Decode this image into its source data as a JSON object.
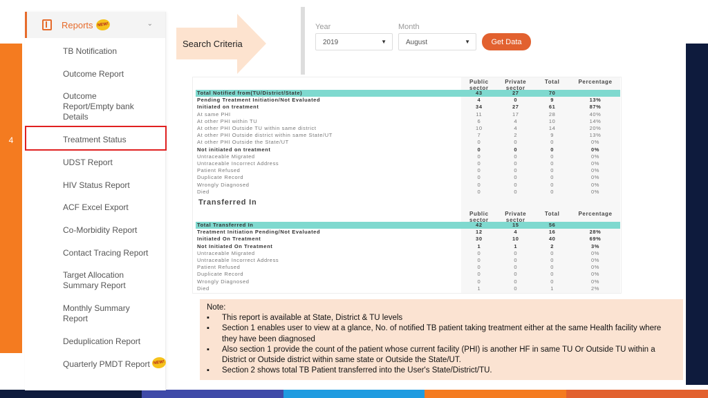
{
  "sidebar": {
    "header": {
      "title": "Reports",
      "badge": "NEW!",
      "icon": "report-icon"
    },
    "items": [
      {
        "label": "TB Notification"
      },
      {
        "label": "Outcome Report"
      },
      {
        "label": "Outcome Report/Empty bank Details"
      },
      {
        "label": "Treatment Status"
      },
      {
        "label": "UDST Report"
      },
      {
        "label": "HIV Status Report"
      },
      {
        "label": "ACF Excel Export"
      },
      {
        "label": "Co-Morbidity Report"
      },
      {
        "label": "Contact Tracing Report"
      },
      {
        "label": "Target Allocation Summary Report"
      },
      {
        "label": "Monthly Summary Report"
      },
      {
        "label": "Deduplication Report"
      },
      {
        "label": "Quarterly PMDT Report"
      }
    ],
    "quarterly_badge": "NEW!",
    "step_number": "4"
  },
  "callout": {
    "label": "Search Criteria"
  },
  "filters": {
    "year_label": "Year",
    "year_value": "2019",
    "month_label": "Month",
    "month_value": "August",
    "get_data_label": "Get Data"
  },
  "report": {
    "columns": [
      "Public sector",
      "Private sector",
      "Total",
      "Percentage"
    ],
    "section1": [
      {
        "label": "Total Notified from(TU/District/State)",
        "v": [
          "43",
          "27",
          "70",
          ""
        ],
        "style": "hl"
      },
      {
        "label": "Pending Treatment Initiation/Not Evaluated",
        "v": [
          "4",
          "0",
          "9",
          "13%"
        ],
        "style": "bold"
      },
      {
        "label": "Initiated on treatment",
        "v": [
          "34",
          "27",
          "61",
          "87%"
        ],
        "style": "bold"
      },
      {
        "label": "At same PHI",
        "v": [
          "11",
          "17",
          "28",
          "40%"
        ],
        "style": "muted"
      },
      {
        "label": "At other PHI within TU",
        "v": [
          "6",
          "4",
          "10",
          "14%"
        ],
        "style": "muted"
      },
      {
        "label": "At other PHI Outside TU within same district",
        "v": [
          "10",
          "4",
          "14",
          "20%"
        ],
        "style": "muted"
      },
      {
        "label": "At other PHI Outside district within same State/UT",
        "v": [
          "7",
          "2",
          "9",
          "13%"
        ],
        "style": "muted"
      },
      {
        "label": "At other PHI Outside the State/UT",
        "v": [
          "0",
          "0",
          "0",
          "0%"
        ],
        "style": "muted"
      },
      {
        "label": "Not initiated on treatment",
        "v": [
          "0",
          "0",
          "0",
          "0%"
        ],
        "style": "bold"
      },
      {
        "label": "Untraceable Migrated",
        "v": [
          "0",
          "0",
          "0",
          "0%"
        ],
        "style": "muted"
      },
      {
        "label": "Untraceable Incorrect Address",
        "v": [
          "0",
          "0",
          "0",
          "0%"
        ],
        "style": "muted"
      },
      {
        "label": "Patient Refused",
        "v": [
          "0",
          "0",
          "0",
          "0%"
        ],
        "style": "muted"
      },
      {
        "label": "Duplicate Record",
        "v": [
          "0",
          "0",
          "0",
          "0%"
        ],
        "style": "muted"
      },
      {
        "label": "Wrongly Diagnosed",
        "v": [
          "0",
          "0",
          "0",
          "0%"
        ],
        "style": "muted"
      },
      {
        "label": "Died",
        "v": [
          "0",
          "0",
          "0",
          "0%"
        ],
        "style": "muted"
      }
    ],
    "section2_title": "Transferred In",
    "section2": [
      {
        "label": "Total Transferred In",
        "v": [
          "42",
          "15",
          "56",
          ""
        ],
        "style": "hl"
      },
      {
        "label": "Treatment Initiation Pending/Not Evaluated",
        "v": [
          "12",
          "4",
          "16",
          "28%"
        ],
        "style": "bold"
      },
      {
        "label": "Initiated On Treatment",
        "v": [
          "30",
          "10",
          "40",
          "69%"
        ],
        "style": "bold"
      },
      {
        "label": "Not Initiated On Treatment",
        "v": [
          "1",
          "1",
          "2",
          "3%"
        ],
        "style": "bold"
      },
      {
        "label": "Untraceable Migrated",
        "v": [
          "0",
          "0",
          "0",
          "0%"
        ],
        "style": "muted"
      },
      {
        "label": "Untraceable Incorrect Address",
        "v": [
          "0",
          "0",
          "0",
          "0%"
        ],
        "style": "muted"
      },
      {
        "label": "Patient Refused",
        "v": [
          "0",
          "0",
          "0",
          "0%"
        ],
        "style": "muted"
      },
      {
        "label": "Duplicate Record",
        "v": [
          "0",
          "0",
          "0",
          "0%"
        ],
        "style": "muted"
      },
      {
        "label": "Wrongly Diagnosed",
        "v": [
          "0",
          "0",
          "0",
          "0%"
        ],
        "style": "muted"
      },
      {
        "label": "Died",
        "v": [
          "1",
          "0",
          "1",
          "2%"
        ],
        "style": "muted"
      }
    ]
  },
  "note": {
    "title": "Note:",
    "points": [
      "This report is available at State, District & TU levels",
      "Section 1 enables user to view at a glance, No. of notified TB patient taking treatment either at the same Health facility where they have been diagnosed",
      "Also section 1 provide the count of the patient whose current facility (PHI) is another HF in same TU Or Outside TU within a District or Outside district within same state or Outside the State/UT.",
      "Section 2 shows total TB Patient transferred into the User's State/District/TU."
    ]
  },
  "colors": {
    "accent_orange": "#f47b20",
    "navy": "#0e1b3d",
    "button": "#e2612f",
    "highlight_row": "#7fd9cf",
    "note_bg": "#fbe3d2",
    "bottom_bar": [
      "#0e1b3d",
      "#3f4aa8",
      "#1f9be0",
      "#f47b20",
      "#e2612f"
    ]
  }
}
